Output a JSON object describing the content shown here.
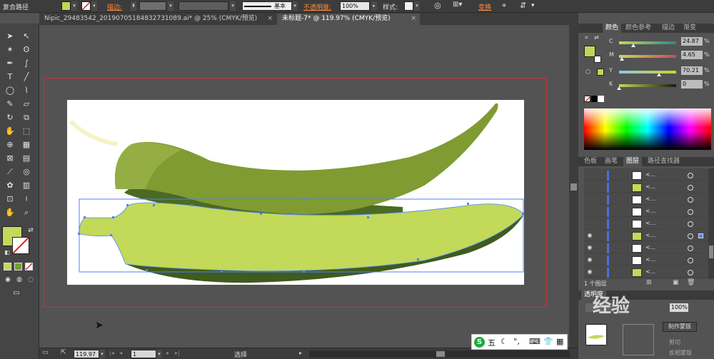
{
  "control_bar": {
    "object_type": "复合路径",
    "stroke_label": "描边:",
    "stroke_style": "基本",
    "opacity_label": "不透明度:",
    "opacity_value": "100%",
    "style_label": "样式:",
    "transform_label": "变换"
  },
  "tabs": [
    {
      "label": "Nipic_29483542_20190705184832731089.ai* @ 25% (CMYK/预览)",
      "close": "×"
    },
    {
      "label": "未标题-7* @ 119.97% (CMYK/预览)",
      "close": "×"
    }
  ],
  "color_panel": {
    "tabs": [
      "颜色",
      "颜色参考",
      "描边",
      "渐变"
    ],
    "channels": [
      {
        "name": "C",
        "value": "24.87",
        "position": 0.249
      },
      {
        "name": "M",
        "value": "4.65",
        "position": 0.047
      },
      {
        "name": "Y",
        "value": "70.21",
        "position": 0.702
      },
      {
        "name": "K",
        "value": "0",
        "position": 0.0
      }
    ],
    "percent": "%",
    "fill_color": "#bdd65a"
  },
  "layers_panel": {
    "tabs": [
      "色板",
      "画笔",
      "图层",
      "路径查找器"
    ],
    "row_name": "<...",
    "layer_count": "1 个图层"
  },
  "transparency_panel": {
    "tab": "透明度",
    "opacity": "100%",
    "make_mask": "制作蒙版",
    "clip": "剪切",
    "invert_mask": "反相蒙版"
  },
  "status_bar": {
    "zoom": "119.97",
    "page": "1",
    "tool_name": "选择"
  },
  "ime": {
    "text": "五"
  },
  "watermark": "经验",
  "colors": {
    "okra_fill": "#c2d95a",
    "okra_mid": "#7d9a2e",
    "okra_dark": "#3f5b1d",
    "selection": "#4d82ff",
    "artboard_border": "#c83434"
  }
}
